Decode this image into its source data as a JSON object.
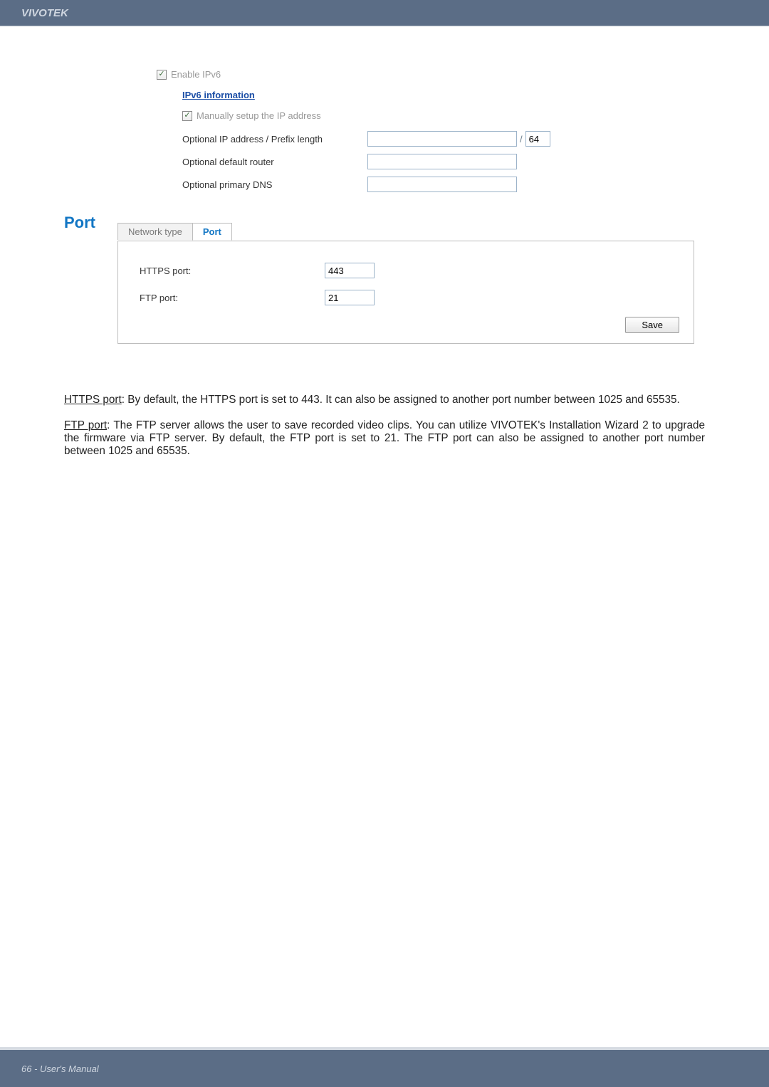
{
  "header": {
    "brand": "VIVOTEK"
  },
  "ipv6": {
    "enable_label": "Enable IPv6",
    "info_link": "IPv6 information",
    "manual_label": "Manually setup the IP address",
    "prefix_label": "Optional IP address / Prefix length",
    "prefix_value": "64",
    "default_router_label": "Optional default router",
    "primary_dns_label": "Optional primary DNS"
  },
  "port_section": {
    "heading": "Port",
    "tabs": {
      "network": "Network type",
      "port": "Port"
    },
    "rows": {
      "https_label": "HTTPS port:",
      "https_value": "443",
      "ftp_label": "FTP port:",
      "ftp_value": "21"
    },
    "save_label": "Save"
  },
  "paragraphs": {
    "p1_lead": "HTTPS port",
    "p1_rest": ": By default, the HTTPS port is set to 443. It can also be assigned to another port number between 1025 and 65535.",
    "p2_lead": "FTP port",
    "p2_rest": ": The FTP server allows the user to save recorded video clips. You can utilize VIVOTEK's Installation Wizard 2 to upgrade the firmware via FTP server. By default, the FTP port is set to 21. The FTP port can also be assigned to another port number between 1025 and 65535."
  },
  "footer": {
    "text": "66 - User's Manual"
  }
}
